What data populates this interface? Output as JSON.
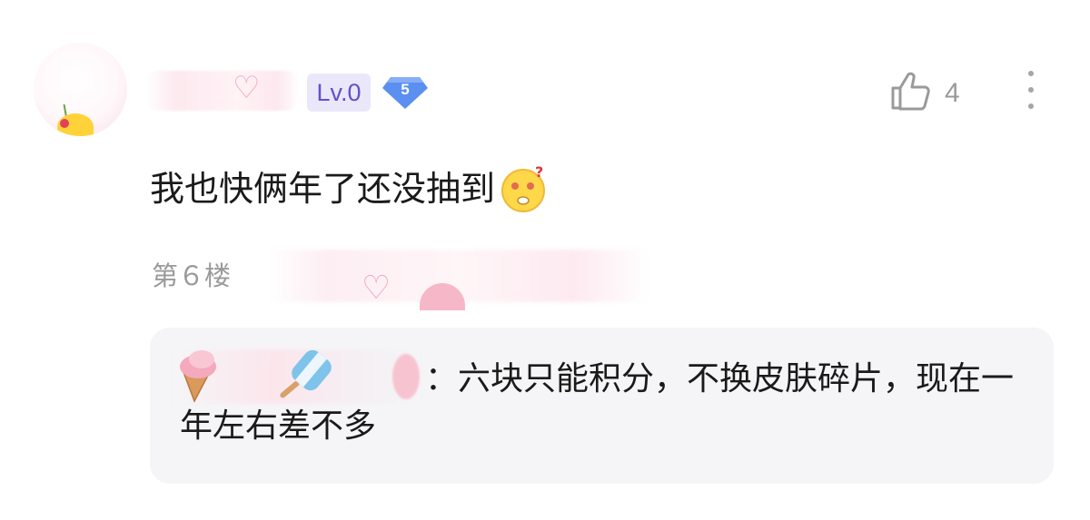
{
  "comment": {
    "level_badge": "Lv.0",
    "diamond_level": "5",
    "like_count": "4",
    "text": "我也快俩年了还没抽到",
    "emoji_icon": "confused-face-icon",
    "floor": "第６楼"
  },
  "reply": {
    "text": "：六块只能积分，不换皮肤碎片，现在一年左右差不多"
  },
  "colors": {
    "level_badge_bg": "#ebe7fb",
    "level_badge_text": "#6252c7",
    "diamond": "#5b8ff0",
    "reply_bg": "#f5f5f7",
    "muted_text": "#9a9a9a"
  }
}
